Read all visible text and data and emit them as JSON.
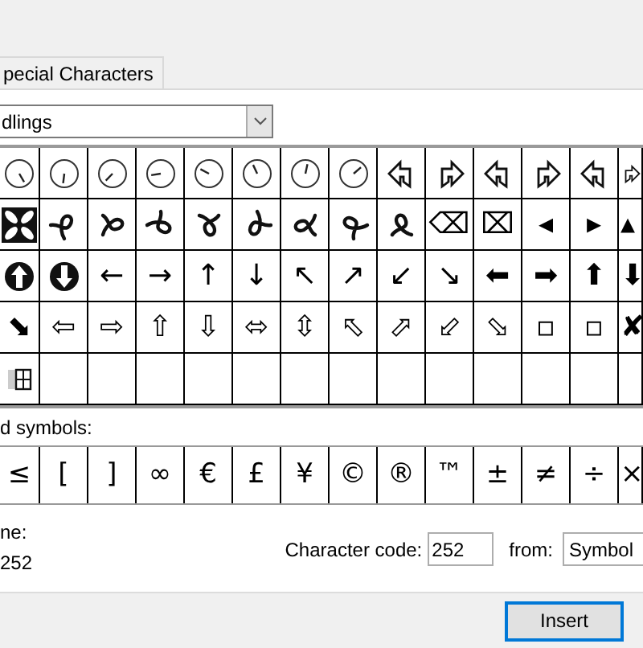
{
  "tabs": [
    {
      "label": "pecial Characters",
      "selected": false
    }
  ],
  "font": {
    "value": "dlings"
  },
  "grid": {
    "rows": [
      [
        {
          "kind": "clock"
        },
        {
          "kind": "clock"
        },
        {
          "kind": "clock"
        },
        {
          "kind": "clock"
        },
        {
          "kind": "clock"
        },
        {
          "kind": "clock"
        },
        {
          "kind": "clock"
        },
        {
          "kind": "clock"
        },
        {
          "kind": "bent-arrow"
        },
        {
          "kind": "bent-arrow"
        },
        {
          "kind": "bent-arrow"
        },
        {
          "kind": "bent-arrow"
        },
        {
          "kind": "bent-arrow"
        },
        {
          "kind": "bent-arrow"
        }
      ],
      [
        {
          "kind": "quatrefoil"
        },
        {
          "kind": "loop"
        },
        {
          "kind": "loop"
        },
        {
          "kind": "loop"
        },
        {
          "kind": "loop"
        },
        {
          "kind": "loop"
        },
        {
          "kind": "loop"
        },
        {
          "kind": "loop"
        },
        {
          "kind": "loop"
        },
        {
          "kind": "glyph",
          "char": "⌫"
        },
        {
          "kind": "glyph",
          "char": "⌧"
        },
        {
          "kind": "glyph",
          "char": "◂"
        },
        {
          "kind": "glyph",
          "char": "▸"
        },
        {
          "kind": "glyph",
          "char": "▴"
        }
      ],
      [
        {
          "kind": "circle-arrow"
        },
        {
          "kind": "circle-arrow"
        },
        {
          "kind": "glyph",
          "char": "←"
        },
        {
          "kind": "glyph",
          "char": "→"
        },
        {
          "kind": "glyph",
          "char": "↑"
        },
        {
          "kind": "glyph",
          "char": "↓"
        },
        {
          "kind": "glyph",
          "char": "↖"
        },
        {
          "kind": "glyph",
          "char": "↗"
        },
        {
          "kind": "glyph",
          "char": "↙"
        },
        {
          "kind": "glyph",
          "char": "↘"
        },
        {
          "kind": "glyph",
          "char": "⬅"
        },
        {
          "kind": "glyph",
          "char": "➡"
        },
        {
          "kind": "glyph",
          "char": "⬆"
        },
        {
          "kind": "glyph",
          "char": "⬇"
        }
      ],
      [
        {
          "kind": "glyph",
          "char": "⬊"
        },
        {
          "kind": "glyph",
          "char": "⇦"
        },
        {
          "kind": "glyph",
          "char": "⇨"
        },
        {
          "kind": "glyph",
          "char": "⇧"
        },
        {
          "kind": "glyph",
          "char": "⇩"
        },
        {
          "kind": "glyph",
          "char": "⬄"
        },
        {
          "kind": "glyph",
          "char": "⇳"
        },
        {
          "kind": "glyph",
          "char": "⬁"
        },
        {
          "kind": "glyph",
          "char": "⬀"
        },
        {
          "kind": "glyph",
          "char": "⬃"
        },
        {
          "kind": "glyph",
          "char": "⬂"
        },
        {
          "kind": "glyph",
          "char": "▫"
        },
        {
          "kind": "glyph",
          "char": "▫"
        },
        {
          "kind": "glyph",
          "char": "✘"
        }
      ],
      [
        {
          "kind": "windows"
        },
        {
          "kind": "blank"
        },
        {
          "kind": "blank"
        },
        {
          "kind": "blank"
        },
        {
          "kind": "blank"
        },
        {
          "kind": "blank"
        },
        {
          "kind": "blank"
        },
        {
          "kind": "blank"
        },
        {
          "kind": "blank"
        },
        {
          "kind": "blank"
        },
        {
          "kind": "blank"
        },
        {
          "kind": "blank"
        },
        {
          "kind": "blank"
        },
        {
          "kind": "blank"
        }
      ]
    ]
  },
  "recent": {
    "label": "d symbols:",
    "symbols": [
      "≤",
      "[",
      "]",
      "∞",
      "€",
      "£",
      "¥",
      "©",
      "®",
      "™",
      "±",
      "≠",
      "÷",
      "×"
    ]
  },
  "name": {
    "label": "ne:",
    "value": "252"
  },
  "character_code": {
    "label": "Character code:",
    "value": "252"
  },
  "from": {
    "label": "from:",
    "value": "Symbol"
  },
  "buttons": [
    {
      "label": "Insert"
    }
  ]
}
